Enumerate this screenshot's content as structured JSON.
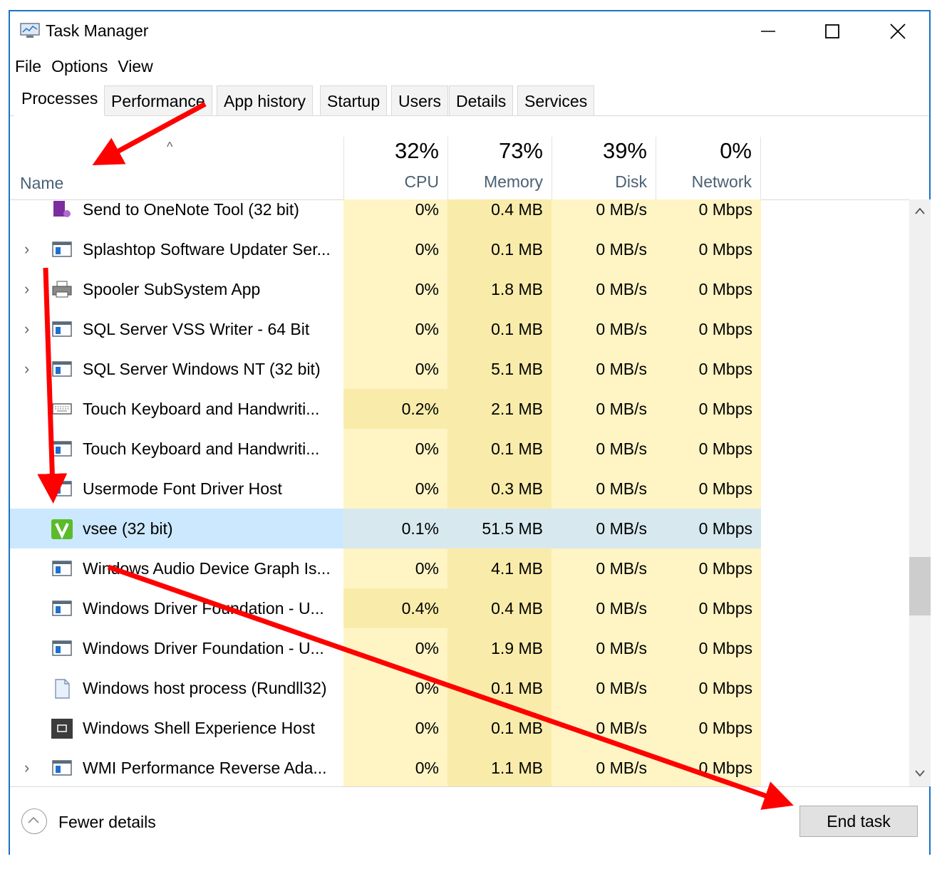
{
  "window": {
    "title": "Task Manager",
    "controls": [
      "minimize",
      "maximize",
      "close"
    ]
  },
  "menu": [
    "File",
    "Options",
    "View"
  ],
  "tabs": [
    {
      "label": "Processes",
      "active": true
    },
    {
      "label": "Performance"
    },
    {
      "label": "App history"
    },
    {
      "label": "Startup"
    },
    {
      "label": "Users"
    },
    {
      "label": "Details"
    },
    {
      "label": "Services"
    }
  ],
  "columns": {
    "name": "Name",
    "cpu": {
      "pct": "32%",
      "label": "CPU"
    },
    "memory": {
      "pct": "73%",
      "label": "Memory"
    },
    "disk": {
      "pct": "39%",
      "label": "Disk"
    },
    "network": {
      "pct": "0%",
      "label": "Network"
    }
  },
  "rows": [
    {
      "name": "Send to OneNote Tool (32 bit)",
      "cpu": "0%",
      "mem": "0.4 MB",
      "disk": "0 MB/s",
      "net": "0 Mbps",
      "icon": "onenote-icon",
      "expand": false
    },
    {
      "name": "Splashtop Software Updater Ser...",
      "cpu": "0%",
      "mem": "0.1 MB",
      "disk": "0 MB/s",
      "net": "0 Mbps",
      "icon": "service-window-icon",
      "expand": true
    },
    {
      "name": "Spooler SubSystem App",
      "cpu": "0%",
      "mem": "1.8 MB",
      "disk": "0 MB/s",
      "net": "0 Mbps",
      "icon": "printer-icon",
      "expand": true
    },
    {
      "name": "SQL Server VSS Writer - 64 Bit",
      "cpu": "0%",
      "mem": "0.1 MB",
      "disk": "0 MB/s",
      "net": "0 Mbps",
      "icon": "service-window-icon",
      "expand": true
    },
    {
      "name": "SQL Server Windows NT (32 bit)",
      "cpu": "0%",
      "mem": "5.1 MB",
      "disk": "0 MB/s",
      "net": "0 Mbps",
      "icon": "service-window-icon",
      "expand": true
    },
    {
      "name": "Touch Keyboard and Handwriti...",
      "cpu": "0.2%",
      "mem": "2.1 MB",
      "disk": "0 MB/s",
      "net": "0 Mbps",
      "icon": "keyboard-icon",
      "expand": false,
      "cpu_hl": true
    },
    {
      "name": "Touch Keyboard and Handwriti...",
      "cpu": "0%",
      "mem": "0.1 MB",
      "disk": "0 MB/s",
      "net": "0 Mbps",
      "icon": "service-window-icon",
      "expand": false
    },
    {
      "name": "Usermode Font Driver Host",
      "cpu": "0%",
      "mem": "0.3 MB",
      "disk": "0 MB/s",
      "net": "0 Mbps",
      "icon": "service-window-icon",
      "expand": false
    },
    {
      "name": "vsee (32 bit)",
      "cpu": "0.1%",
      "mem": "51.5 MB",
      "disk": "0 MB/s",
      "net": "0 Mbps",
      "icon": "vsee-icon",
      "expand": false,
      "selected": true
    },
    {
      "name": "Windows Audio Device Graph Is...",
      "cpu": "0%",
      "mem": "4.1 MB",
      "disk": "0 MB/s",
      "net": "0 Mbps",
      "icon": "service-window-icon",
      "expand": false
    },
    {
      "name": "Windows Driver Foundation - U...",
      "cpu": "0.4%",
      "mem": "0.4 MB",
      "disk": "0 MB/s",
      "net": "0 Mbps",
      "icon": "service-window-icon",
      "expand": false,
      "cpu_hl": true
    },
    {
      "name": "Windows Driver Foundation - U...",
      "cpu": "0%",
      "mem": "1.9 MB",
      "disk": "0 MB/s",
      "net": "0 Mbps",
      "icon": "service-window-icon",
      "expand": false
    },
    {
      "name": "Windows host process (Rundll32)",
      "cpu": "0%",
      "mem": "0.1 MB",
      "disk": "0 MB/s",
      "net": "0 Mbps",
      "icon": "document-icon",
      "expand": false
    },
    {
      "name": "Windows Shell Experience Host",
      "cpu": "0%",
      "mem": "0.1 MB",
      "disk": "0 MB/s",
      "net": "0 Mbps",
      "icon": "shell-icon",
      "expand": false
    },
    {
      "name": "WMI Performance Reverse Ada...",
      "cpu": "0%",
      "mem": "1.1 MB",
      "disk": "0 MB/s",
      "net": "0 Mbps",
      "icon": "service-window-icon",
      "expand": true
    }
  ],
  "footer": {
    "fewer_details": "Fewer details",
    "end_task": "End task"
  },
  "colors": {
    "cpu_bg": "#fff4c4",
    "mem_bg": "#f9ecaa",
    "disk_bg": "#fff4c4",
    "net_bg": "#fff4c4",
    "selected_row": "#cce8ff",
    "annotation_arrow": "#ff0000"
  }
}
